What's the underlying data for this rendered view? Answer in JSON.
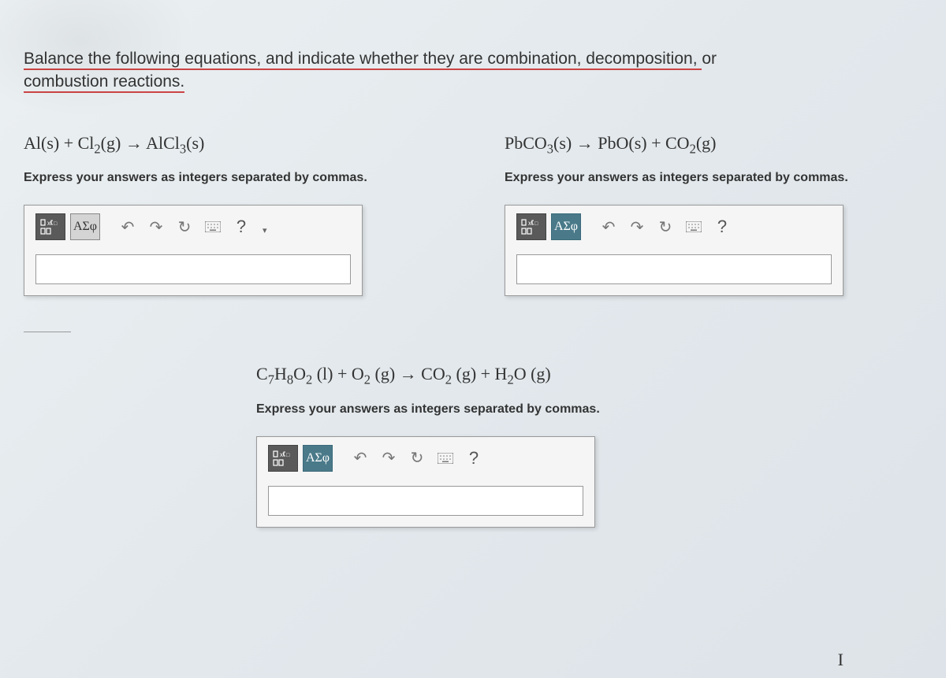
{
  "instruction": {
    "part1": "Balance the following equations, and indicate whether they are combination, decomposition, ",
    "part2": "or",
    "part3": "combustion reactions."
  },
  "sub_instruction": "Express your answers as integers separated by commas.",
  "questions": {
    "q1": {
      "eq_html": "Al(s) + Cl<sub>2</sub>(g) → AlCl<sub>3</sub>(s)"
    },
    "q2": {
      "eq_html": "PbCO<sub>3</sub>(s) → PbO(s) + CO<sub>2</sub>(g)"
    },
    "q3": {
      "eq_html": "C<sub>7</sub>H<sub>8</sub>O<sub>2</sub> (l) + O<sub>2</sub> (g) → CO<sub>2</sub> (g) + H<sub>2</sub>O (g)"
    }
  },
  "toolbar": {
    "greek_label": "ΑΣφ",
    "undo_label": "↶",
    "redo_label": "↷",
    "reset_label": "↻",
    "help_label": "?"
  }
}
